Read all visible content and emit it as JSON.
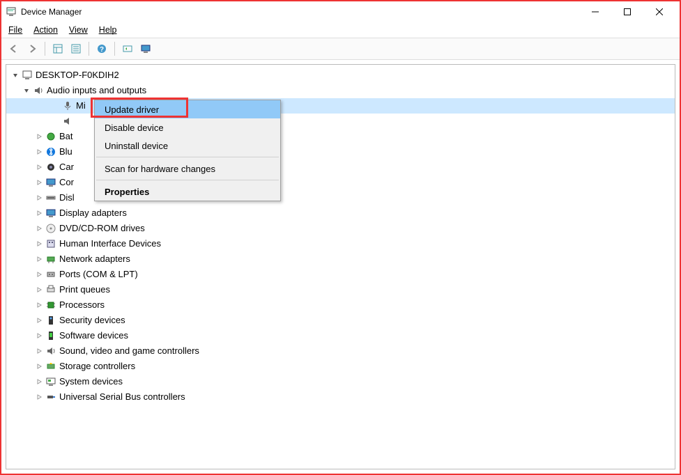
{
  "window": {
    "title": "Device Manager"
  },
  "menu": {
    "file": "File",
    "action": "Action",
    "view": "View",
    "help": "Help"
  },
  "tree": {
    "root": "DESKTOP-F0KDIH2",
    "audio_category": "Audio inputs and outputs",
    "selected_device_prefix": "Mi",
    "second_audio_suffix": "",
    "categories": [
      "Bat",
      "Blu",
      "Car",
      "Cor",
      "Disl",
      "Display adapters",
      "DVD/CD-ROM drives",
      "Human Interface Devices",
      "Network adapters",
      "Ports (COM & LPT)",
      "Print queues",
      "Processors",
      "Security devices",
      "Software devices",
      "Sound, video and game controllers",
      "Storage controllers",
      "System devices",
      "Universal Serial Bus controllers"
    ]
  },
  "context_menu": {
    "update": "Update driver",
    "disable": "Disable device",
    "uninstall": "Uninstall device",
    "scan": "Scan for hardware changes",
    "properties": "Properties"
  }
}
